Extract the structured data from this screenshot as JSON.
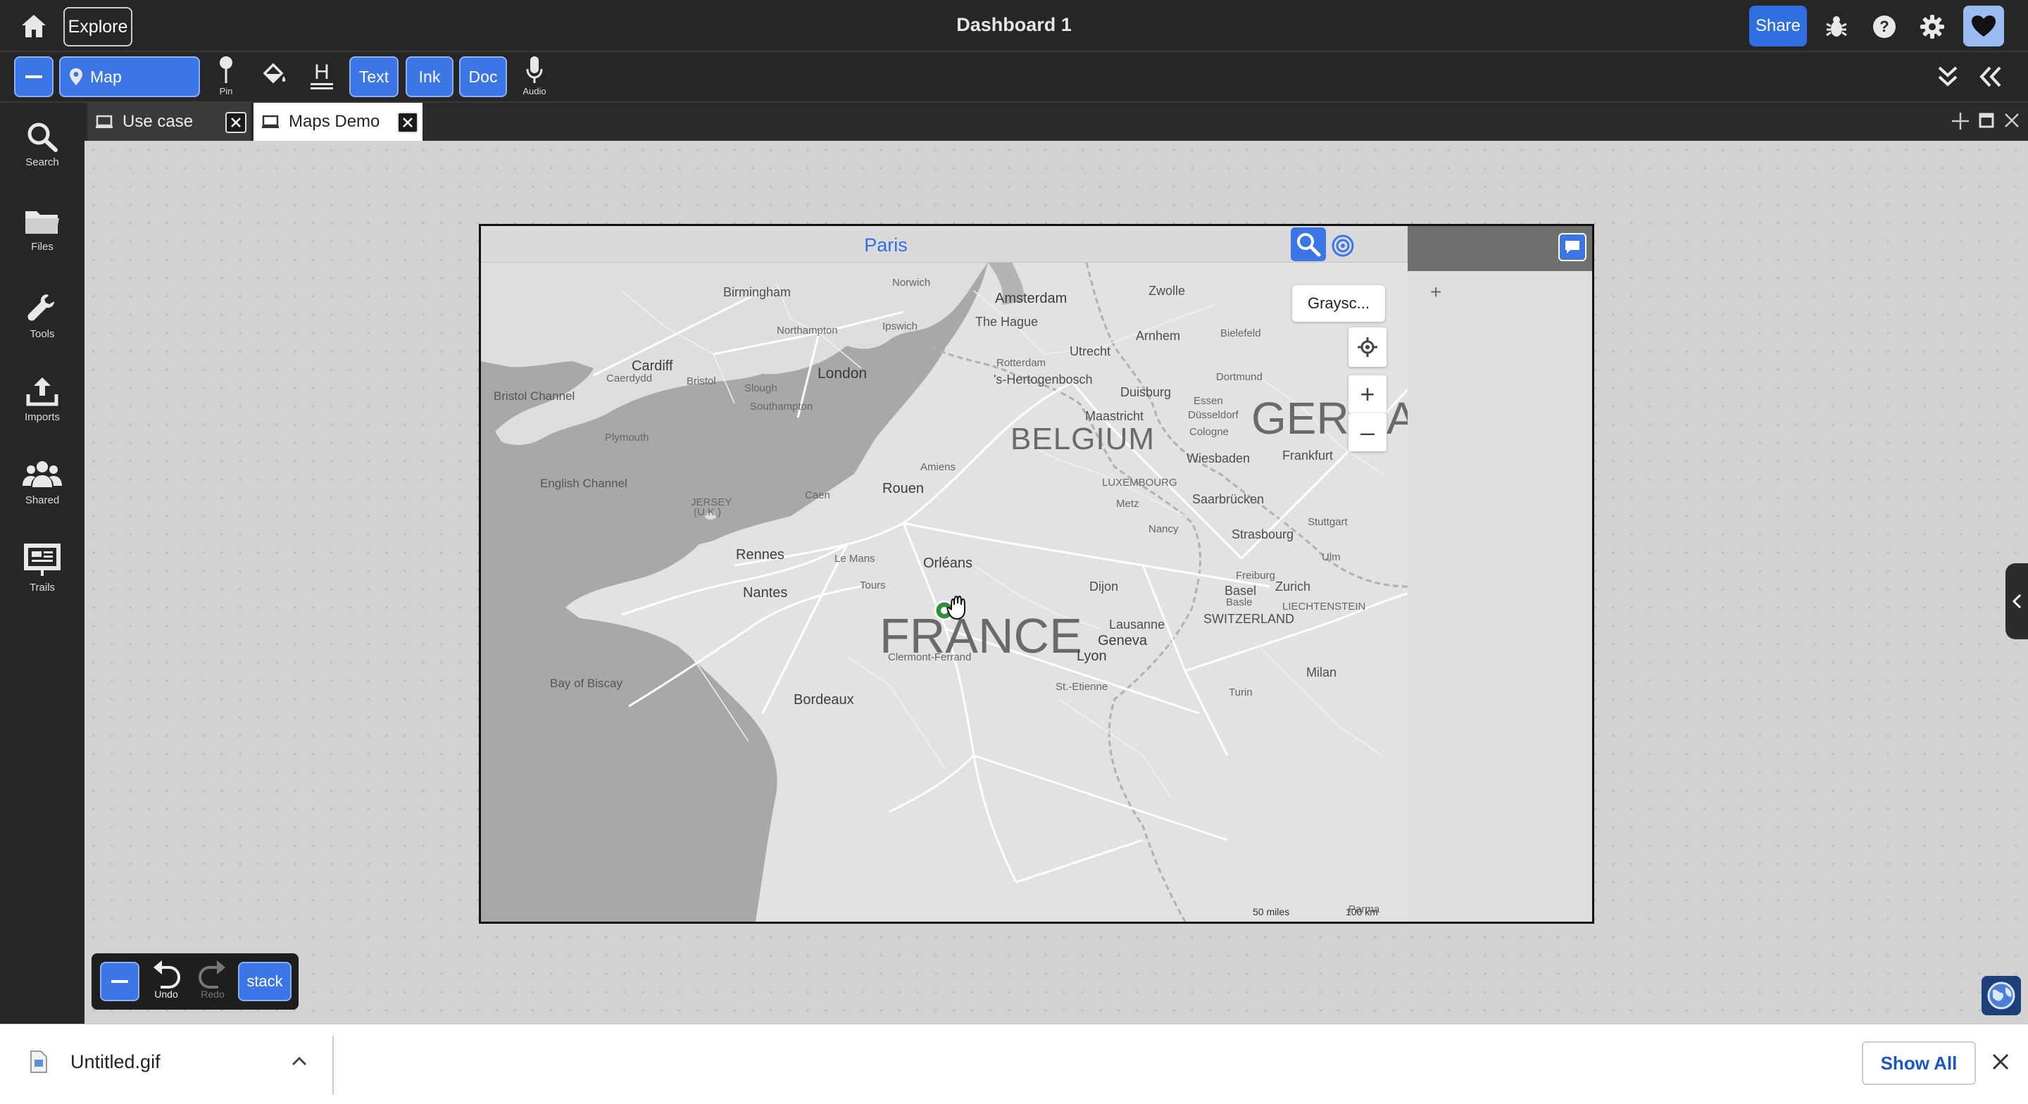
{
  "header": {
    "explore_label": "Explore",
    "title": "Dashboard 1",
    "share_label": "Share"
  },
  "toolbar": {
    "map_label": "Map",
    "pin_label": "Pin",
    "text_label": "Text",
    "ink_label": "Ink",
    "doc_label": "Doc",
    "audio_label": "Audio"
  },
  "sidebar": {
    "items": [
      {
        "label": "Search",
        "icon": "search-icon"
      },
      {
        "label": "Files",
        "icon": "folder-icon"
      },
      {
        "label": "Tools",
        "icon": "wrench-icon"
      },
      {
        "label": "Imports",
        "icon": "upload-icon"
      },
      {
        "label": "Shared",
        "icon": "people-icon"
      },
      {
        "label": "Trails",
        "icon": "presentation-icon"
      }
    ]
  },
  "tabs": [
    {
      "label": "Use case",
      "active": false
    },
    {
      "label": "Maps Demo",
      "active": true
    }
  ],
  "map": {
    "title": "Paris",
    "style_label": "Graysc...",
    "zoom_in": "+",
    "zoom_out": "–",
    "panel_plus": "+",
    "scale_miles": "50 miles",
    "scale_km": "100 km",
    "labels": {
      "norwich": "Norwich",
      "birmingham": "Birmingham",
      "amsterdam": "Amsterdam",
      "zwolle": "Zwolle",
      "the_hague": "The Hague",
      "northampton": "Northampton",
      "ipswich": "Ipswich",
      "utrecht": "Utrecht",
      "arnhem": "Arnhem",
      "bielefeld": "Bielefeld",
      "rotterdam": "Rotterdam",
      "hertogenbosch": "'s-Hertogenbosch",
      "cardiff": "Cardiff",
      "caerdydd": "Caerdydd",
      "bristol": "Bristol",
      "slough": "Slough",
      "london": "London",
      "dortmund": "Dortmund",
      "duisburg": "Duisburg",
      "essen": "Essen",
      "bristol_channel": "Bristol Channel",
      "southampton": "Southampton",
      "maastricht": "Maastricht",
      "dusseldorf": "Düsseldorf",
      "germany": "GERMANY",
      "cologne": "Cologne",
      "belgium": "BELGIUM",
      "plymouth": "Plymouth",
      "wiesbaden": "Wiesbaden",
      "frankfurt": "Frankfurt",
      "amiens": "Amiens",
      "english_channel": "English Channel",
      "luxembourg": "LUXEMBOURG",
      "rouen": "Rouen",
      "saarbrucken": "Saarbrücken",
      "jersey": "JERSEY",
      "uk": "(U.K.)",
      "caen": "Caen",
      "metz": "Metz",
      "stuttgart": "Stuttgart",
      "nancy": "Nancy",
      "strasbourg": "Strasbourg",
      "ulm": "Ulm",
      "rennes": "Rennes",
      "le_mans": "Le Mans",
      "orleans": "Orléans",
      "freiburg": "Freiburg",
      "dijon": "Dijon",
      "zurich": "Zurich",
      "basel": "Basel",
      "basle": "Basle",
      "nantes": "Nantes",
      "tours": "Tours",
      "liechtenstein": "LIECHTENSTEIN",
      "france": "FRANCE",
      "switzerland": "SWITZERLAND",
      "lausanne": "Lausanne",
      "geneva": "Geneva",
      "clermont_ferrand": "Clermont-Ferrand",
      "lyon": "Lyon",
      "milan": "Milan",
      "bay_of_biscay": "Bay of Biscay",
      "st_etienne": "St.-Etienne",
      "turin": "Turin",
      "bordeaux": "Bordeaux",
      "parma": "Parma"
    }
  },
  "palette": {
    "undo_label": "Undo",
    "redo_label": "Redo",
    "stack_label": "stack"
  },
  "download": {
    "filename": "Untitled.gif",
    "show_all_label": "Show All"
  },
  "colors": {
    "accent": "#3c76e6",
    "chrome": "#262626",
    "canvas": "#d2d2d2"
  }
}
